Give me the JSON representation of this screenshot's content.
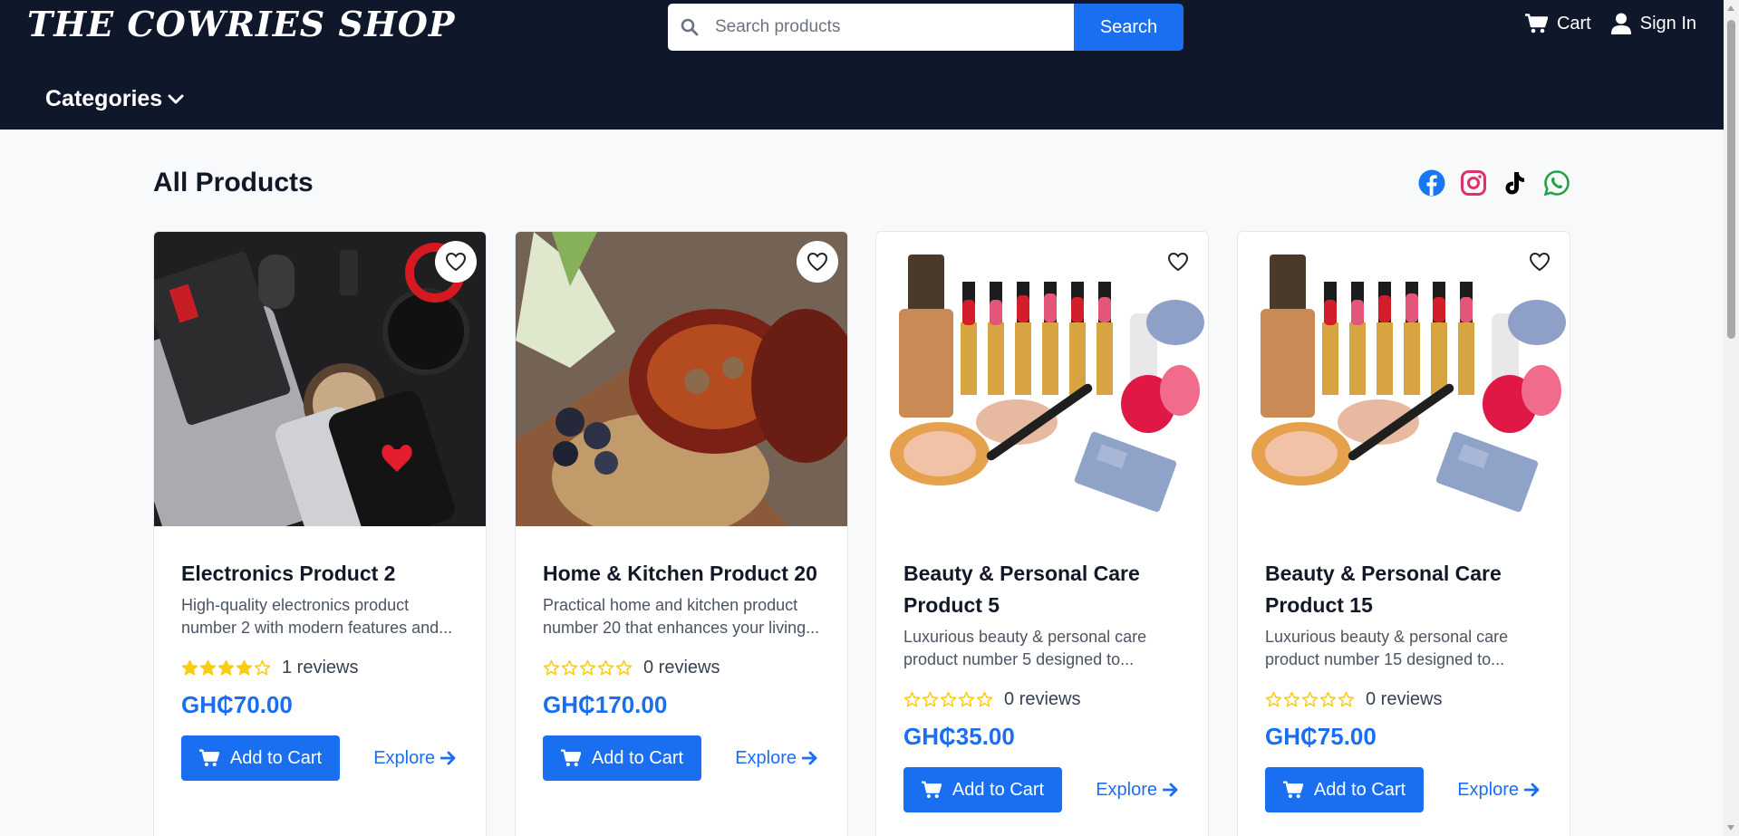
{
  "header": {
    "logo": "THE COWRIES SHOP",
    "search": {
      "placeholder": "Search products",
      "value": "",
      "button_label": "Search"
    },
    "cart_label": "Cart",
    "signin_label": "Sign In",
    "categories_label": "Categories"
  },
  "main": {
    "section_title": "All Products",
    "socials": [
      "facebook-icon",
      "instagram-icon",
      "tiktok-icon",
      "whatsapp-icon"
    ]
  },
  "products": [
    {
      "title": "Electronics Product 2",
      "description": "High-quality electronics product number 2 with modern features and...",
      "rating": 4,
      "reviews": "1 reviews",
      "price": "GH₵70.00",
      "add_label": "Add to Cart",
      "explore_label": "Explore"
    },
    {
      "title": "Home & Kitchen Product 20",
      "description": "Practical home and kitchen product number 20 that enhances your living...",
      "rating": 0,
      "reviews": "0 reviews",
      "price": "GH₵170.00",
      "add_label": "Add to Cart",
      "explore_label": "Explore"
    },
    {
      "title": "Beauty & Personal Care Product 5",
      "description": "Luxurious beauty & personal care product number 5 designed to...",
      "rating": 0,
      "reviews": "0 reviews",
      "price": "GH₵35.00",
      "add_label": "Add to Cart",
      "explore_label": "Explore"
    },
    {
      "title": "Beauty & Personal Care Product 15",
      "description": "Luxurious beauty & personal care product number 15 designed to...",
      "rating": 0,
      "reviews": "0 reviews",
      "price": "GH₵75.00",
      "add_label": "Add to Cart",
      "explore_label": "Explore"
    }
  ],
  "colors": {
    "header_bg": "#0f172a",
    "accent": "#1a6ff0",
    "star": "#facc15"
  }
}
